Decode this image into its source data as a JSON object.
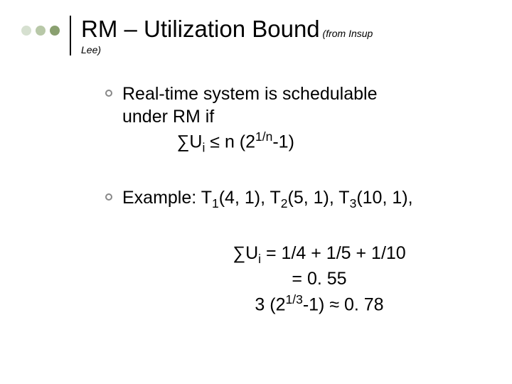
{
  "title": {
    "main": "RM – Utilization Bound",
    "attribution_inline": " (from Insup",
    "attribution_line2": "Lee)"
  },
  "bullets": [
    {
      "line1": "Real-time system is schedulable",
      "line2": "under RM if"
    },
    {
      "line1_prefix": "Example: T",
      "t1_sub": "1",
      "t1_args": "(4, 1), T",
      "t2_sub": "2",
      "t2_args": "(5, 1), T",
      "t3_sub": "3",
      "t3_args": "(10, 1),"
    }
  ],
  "formula1": {
    "prefix": "∑U",
    "sub": "i",
    "mid": " ≤ n (2",
    "sup": "1/n",
    "suffix": "-1)"
  },
  "result": {
    "l1_prefix": "∑U",
    "l1_sub": "i",
    "l1_rest": " = 1/4 + 1/5 + 1/10",
    "l2": "= 0. 55",
    "l3_prefix": "3 (2",
    "l3_sup": "1/3",
    "l3_rest": "-1) ≈ 0. 78"
  }
}
